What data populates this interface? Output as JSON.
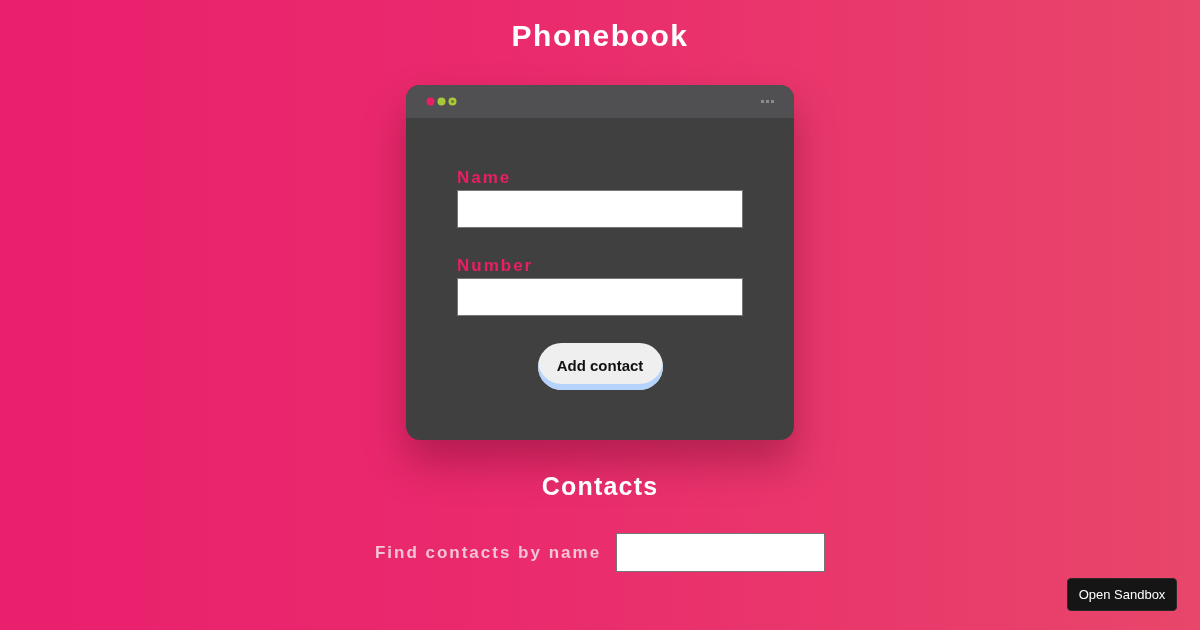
{
  "title": "Phonebook",
  "form": {
    "fields": [
      {
        "label": "Name"
      },
      {
        "label": "Number"
      }
    ],
    "submit_button": "Add contact"
  },
  "contacts": {
    "heading": "Contacts",
    "filter": {
      "label": "Find contacts by name"
    }
  },
  "sandbox_button": "Open Sandbox"
}
